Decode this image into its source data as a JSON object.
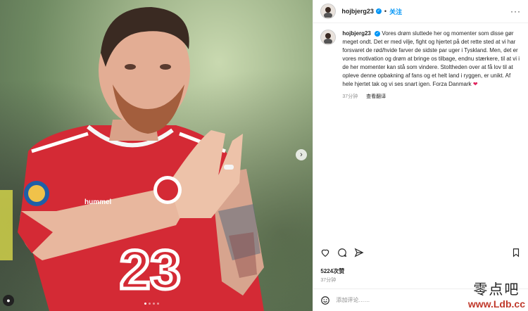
{
  "post": {
    "username": "hojbjerg23",
    "follow_label": "关注",
    "more_label": "···",
    "caption": "Vores drøm sluttede her og momenter som disse gør meget ondt. Det er med vilje, fight og hjertet på det rette sted at vi har forsvaret de rød/hvide farver de sidste par uger i Tyskland. Men, det er vores motivation og drøm at bringe os tilbage, endnu stærkere, til at vi i de her momenter kan stå som vindere. Stoltheden over at få lov til at opleve denne opbakning af fans og et helt land i ryggen, er unikt. Af hele hjertet tak og vi ses snart igen. Forza Danmark",
    "caption_emoji": "❤",
    "caption_time": "37分钟",
    "translate_label": "查看翻译",
    "likes": "5224次赞",
    "time": "37分钟",
    "comment_placeholder": "添加评论……"
  },
  "photo": {
    "jersey_number": "23",
    "brand": "hummel",
    "next_icon": "chevron-right-icon",
    "total_slides": 4,
    "active_slide": 1
  },
  "watermark": {
    "cn": "零点吧",
    "url": "www.Ldb.cc"
  },
  "colors": {
    "accent": "#0095f6",
    "jersey_red": "#d42a35",
    "heart": "#e0245e",
    "watermark_red": "#c0392b"
  }
}
